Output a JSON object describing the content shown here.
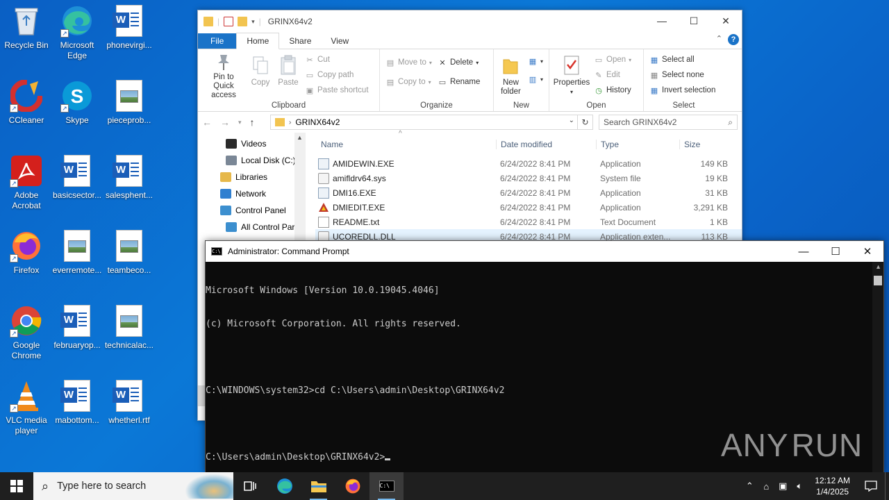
{
  "desktop": {
    "icons": [
      {
        "label": "Recycle Bin"
      },
      {
        "label": "Microsoft Edge"
      },
      {
        "label": "phonevirgi..."
      },
      {
        "label": "CCleaner"
      },
      {
        "label": "Skype"
      },
      {
        "label": "pieceprob..."
      },
      {
        "label": "Adobe Acrobat"
      },
      {
        "label": "basicsector..."
      },
      {
        "label": "salesphent..."
      },
      {
        "label": "Firefox"
      },
      {
        "label": "everremote..."
      },
      {
        "label": "teambeco..."
      },
      {
        "label": "Google Chrome"
      },
      {
        "label": "februaryop..."
      },
      {
        "label": "technicalac..."
      },
      {
        "label": "VLC media player"
      },
      {
        "label": "mabottom..."
      },
      {
        "label": "whetherl.rtf"
      }
    ]
  },
  "explorer": {
    "title": "GRINX64v2",
    "tabs": [
      "File",
      "Home",
      "Share",
      "View"
    ],
    "ribbon": {
      "clipboard": {
        "name": "Clipboard",
        "pin": "Pin to Quick access",
        "copy": "Copy",
        "paste": "Paste",
        "cut": "Cut",
        "copy_path": "Copy path",
        "paste_shortcut": "Paste shortcut"
      },
      "organize": {
        "name": "Organize",
        "move_to": "Move to",
        "copy_to": "Copy to",
        "delete": "Delete",
        "rename": "Rename"
      },
      "new": {
        "name": "New",
        "new_folder": "New folder"
      },
      "open": {
        "name": "Open",
        "properties": "Properties",
        "open": "Open",
        "edit": "Edit",
        "history": "History"
      },
      "select": {
        "name": "Select",
        "select_all": "Select all",
        "select_none": "Select none",
        "invert": "Invert selection"
      }
    },
    "address": {
      "path": "GRINX64v2",
      "search_placeholder": "Search GRINX64v2"
    },
    "navpane": [
      {
        "label": "Videos",
        "color": "#2a2a2a"
      },
      {
        "label": "Local Disk (C:)",
        "color": "#7a8796"
      },
      {
        "label": "Libraries",
        "color": "#e6b84a"
      },
      {
        "label": "Network",
        "color": "#2f7fd0"
      },
      {
        "label": "Control Panel",
        "color": "#3c8fcf"
      },
      {
        "label": "All Control Par",
        "color": "#3c8fcf"
      }
    ],
    "columns": {
      "name": "Name",
      "date": "Date modified",
      "type": "Type",
      "size": "Size"
    },
    "files": [
      {
        "name": "AMIDEWIN.EXE",
        "date": "6/24/2022 8:41 PM",
        "type": "Application",
        "size": "149 KB",
        "icon": "exe"
      },
      {
        "name": "amifldrv64.sys",
        "date": "6/24/2022 8:41 PM",
        "type": "System file",
        "size": "19 KB",
        "icon": "sys"
      },
      {
        "name": "DMI16.EXE",
        "date": "6/24/2022 8:41 PM",
        "type": "Application",
        "size": "31 KB",
        "icon": "exe"
      },
      {
        "name": "DMIEDIT.EXE",
        "date": "6/24/2022 8:41 PM",
        "type": "Application",
        "size": "3,291 KB",
        "icon": "dmi"
      },
      {
        "name": "README.txt",
        "date": "6/24/2022 8:41 PM",
        "type": "Text Document",
        "size": "1 KB",
        "icon": "txt"
      },
      {
        "name": "UCOREDLL.DLL",
        "date": "6/24/2022 8:41 PM",
        "type": "Application exten...",
        "size": "113 KB",
        "icon": "sys"
      }
    ]
  },
  "cmd": {
    "title": "Administrator: Command Prompt",
    "lines": [
      "Microsoft Windows [Version 10.0.19045.4046]",
      "(c) Microsoft Corporation. All rights reserved.",
      "",
      "C:\\WINDOWS\\system32>cd C:\\Users\\admin\\Desktop\\GRINX64v2",
      "",
      "C:\\Users\\admin\\Desktop\\GRINX64v2>"
    ]
  },
  "watermark": {
    "left": "ANY",
    "right": "RUN"
  },
  "taskbar": {
    "search_placeholder": "Type here to search",
    "time": "12:12 AM",
    "date": "1/4/2025"
  },
  "colors": {
    "desktop": "#0b78d7",
    "accent": "#1a73c8",
    "taskbar": "#1f1f1f",
    "console_bg": "#0c0c0c",
    "console_fg": "#cccccc"
  }
}
